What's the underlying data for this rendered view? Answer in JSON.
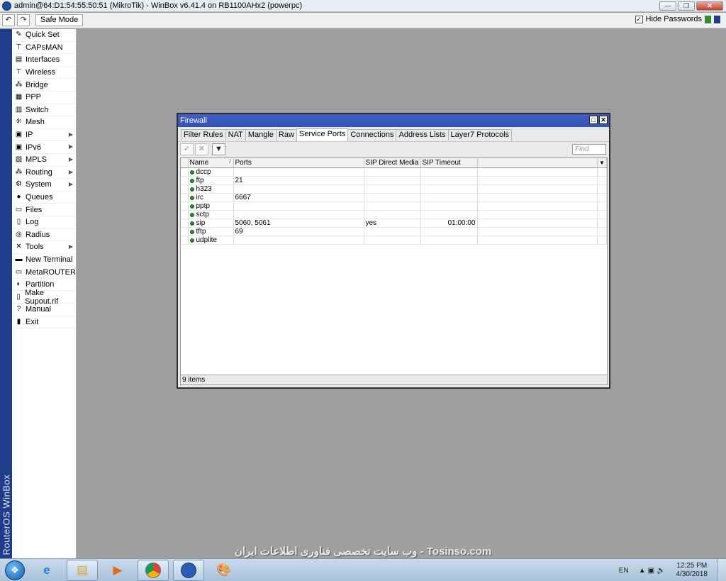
{
  "window": {
    "title": "admin@64:D1:54:55:50:51 (MikroTik) - WinBox v6.41.4 on RB1100AHx2 (powerpc)",
    "controls": [
      "minimize",
      "restore",
      "close"
    ]
  },
  "toolbar": {
    "undo_icon": "undo-icon",
    "redo_icon": "redo-icon",
    "safe_mode_label": "Safe Mode",
    "hide_passwords_label": "Hide Passwords",
    "hide_passwords_checked": true,
    "status_colors": [
      "#3c8a2e",
      "#1e3f8a"
    ]
  },
  "vertical_label": "RouterOS WinBox",
  "sidebar": {
    "items": [
      {
        "label": "Quick Set",
        "icon": "quick-set-icon",
        "submenu": false
      },
      {
        "label": "CAPsMAN",
        "icon": "antenna-icon",
        "submenu": false
      },
      {
        "label": "Interfaces",
        "icon": "interfaces-icon",
        "submenu": false
      },
      {
        "label": "Wireless",
        "icon": "wireless-icon",
        "submenu": false
      },
      {
        "label": "Bridge",
        "icon": "bridge-icon",
        "submenu": false
      },
      {
        "label": "PPP",
        "icon": "ppp-icon",
        "submenu": false
      },
      {
        "label": "Switch",
        "icon": "switch-icon",
        "submenu": false
      },
      {
        "label": "Mesh",
        "icon": "mesh-icon",
        "submenu": false
      },
      {
        "label": "IP",
        "icon": "ip-icon",
        "submenu": true
      },
      {
        "label": "IPv6",
        "icon": "ipv6-icon",
        "submenu": true
      },
      {
        "label": "MPLS",
        "icon": "mpls-icon",
        "submenu": true
      },
      {
        "label": "Routing",
        "icon": "routing-icon",
        "submenu": true
      },
      {
        "label": "System",
        "icon": "gear-icon",
        "submenu": true
      },
      {
        "label": "Queues",
        "icon": "queues-icon",
        "submenu": false
      },
      {
        "label": "Files",
        "icon": "folder-icon",
        "submenu": false
      },
      {
        "label": "Log",
        "icon": "log-icon",
        "submenu": false
      },
      {
        "label": "Radius",
        "icon": "radius-icon",
        "submenu": false
      },
      {
        "label": "Tools",
        "icon": "tools-icon",
        "submenu": true
      },
      {
        "label": "New Terminal",
        "icon": "terminal-icon",
        "submenu": false
      },
      {
        "label": "MetaROUTER",
        "icon": "metarouter-icon",
        "submenu": false
      },
      {
        "label": "Partition",
        "icon": "partition-icon",
        "submenu": false
      },
      {
        "label": "Make Supout.rif",
        "icon": "supout-icon",
        "submenu": false
      },
      {
        "label": "Manual",
        "icon": "help-icon",
        "submenu": false
      },
      {
        "label": "Exit",
        "icon": "exit-icon",
        "submenu": false
      }
    ]
  },
  "firewall": {
    "title": "Firewall",
    "tabs": [
      "Filter Rules",
      "NAT",
      "Mangle",
      "Raw",
      "Service Ports",
      "Connections",
      "Address Lists",
      "Layer7 Protocols"
    ],
    "active_tab": "Service Ports",
    "find_placeholder": "Find",
    "columns": [
      "Name",
      "Ports",
      "SIP Direct Media",
      "SIP Timeout"
    ],
    "sort_indicator": "/",
    "rows": [
      {
        "name": "dccp",
        "ports": "",
        "sip_direct_media": "",
        "sip_timeout": ""
      },
      {
        "name": "ftp",
        "ports": "21",
        "sip_direct_media": "",
        "sip_timeout": ""
      },
      {
        "name": "h323",
        "ports": "",
        "sip_direct_media": "",
        "sip_timeout": ""
      },
      {
        "name": "irc",
        "ports": "6667",
        "sip_direct_media": "",
        "sip_timeout": ""
      },
      {
        "name": "pptp",
        "ports": "",
        "sip_direct_media": "",
        "sip_timeout": ""
      },
      {
        "name": "sctp",
        "ports": "",
        "sip_direct_media": "",
        "sip_timeout": ""
      },
      {
        "name": "sip",
        "ports": "5060, 5061",
        "sip_direct_media": "yes",
        "sip_timeout": "01:00:00"
      },
      {
        "name": "tftp",
        "ports": "69",
        "sip_direct_media": "",
        "sip_timeout": ""
      },
      {
        "name": "udplite",
        "ports": "",
        "sip_direct_media": "",
        "sip_timeout": ""
      }
    ],
    "status": "9 items"
  },
  "watermark": "وب سایت تخصصی فناوری اطلاعات ایران - Tosinso.com",
  "taskbar": {
    "apps": [
      "internet-explorer-icon",
      "file-explorer-icon",
      "media-player-icon",
      "chrome-icon",
      "winbox-icon",
      "paint-icon"
    ],
    "language": "EN",
    "time": "12:25 PM",
    "date": "4/30/2018"
  }
}
